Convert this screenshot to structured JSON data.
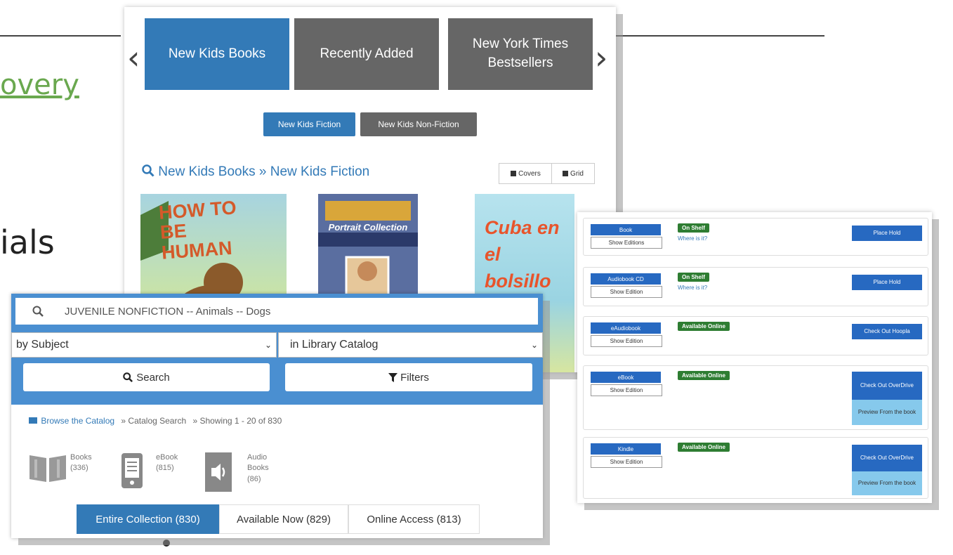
{
  "slide": {
    "link_fragment": "overy",
    "text_fragment": "ials"
  },
  "carousel": {
    "tabs": [
      {
        "label": "New Kids Books",
        "active": true
      },
      {
        "label": "Recently Added",
        "active": false
      },
      {
        "label": "New York Times Bestsellers",
        "active": false
      }
    ],
    "subtabs": [
      {
        "label": "New Kids Fiction",
        "active": true
      },
      {
        "label": "New Kids Non-Fiction",
        "active": false
      }
    ],
    "breadcrumb": "New Kids Books » New Kids Fiction",
    "view_buttons": [
      "Covers",
      "Grid"
    ],
    "covers": [
      {
        "title": "HOW TO BE HUMAN"
      },
      {
        "title": "Portrait Collection"
      },
      {
        "title": "Cuba en el bolsillo"
      }
    ]
  },
  "search": {
    "query": "JUVENILE NONFICTION -- Animals -- Dogs",
    "search_by": "by Subject",
    "search_in": "in Library Catalog",
    "search_label": "Search",
    "filters_label": "Filters",
    "breadcrumb": {
      "browse": "Browse the Catalog",
      "catalog": "» Catalog Search",
      "showing": "» Showing 1 - 20 of 830"
    },
    "formats": [
      {
        "line1": "Books",
        "line2": "(336)",
        "line3": ""
      },
      {
        "line1": "eBook",
        "line2": "(815)",
        "line3": ""
      },
      {
        "line1": "Audio",
        "line2": "Books",
        "line3": "(86)"
      }
    ],
    "availability": [
      {
        "label": "Entire Collection (830)",
        "active": true
      },
      {
        "label": "Available Now (829)",
        "active": false
      },
      {
        "label": "Online Access (813)",
        "active": false
      }
    ]
  },
  "results": [
    {
      "format": "Book",
      "editions": "Show Editions",
      "status": "On Shelf",
      "where": "Where is it?",
      "action": "Place Hold",
      "preview": ""
    },
    {
      "format": "Audiobook CD",
      "editions": "Show Edition",
      "status": "On Shelf",
      "where": "Where is it?",
      "action": "Place Hold",
      "preview": ""
    },
    {
      "format": "eAudiobook",
      "editions": "Show Edition",
      "status": "Available Online",
      "where": "",
      "action": "Check Out Hoopla",
      "preview": ""
    },
    {
      "format": "eBook",
      "editions": "Show Edition",
      "status": "Available Online",
      "where": "",
      "action": "Check Out OverDrive",
      "preview": "Preview From the book"
    },
    {
      "format": "Kindle",
      "editions": "Show Edition",
      "status": "Available Online",
      "where": "",
      "action": "Check Out OverDrive",
      "preview": "Preview From the book"
    }
  ],
  "colors": {
    "primary": "#337ab7",
    "tab_inactive": "#666666",
    "search_bar": "#4a8fd1",
    "status_green": "#2e7d32",
    "preview": "#86c9ec",
    "slide_link": "#6aa84f"
  }
}
